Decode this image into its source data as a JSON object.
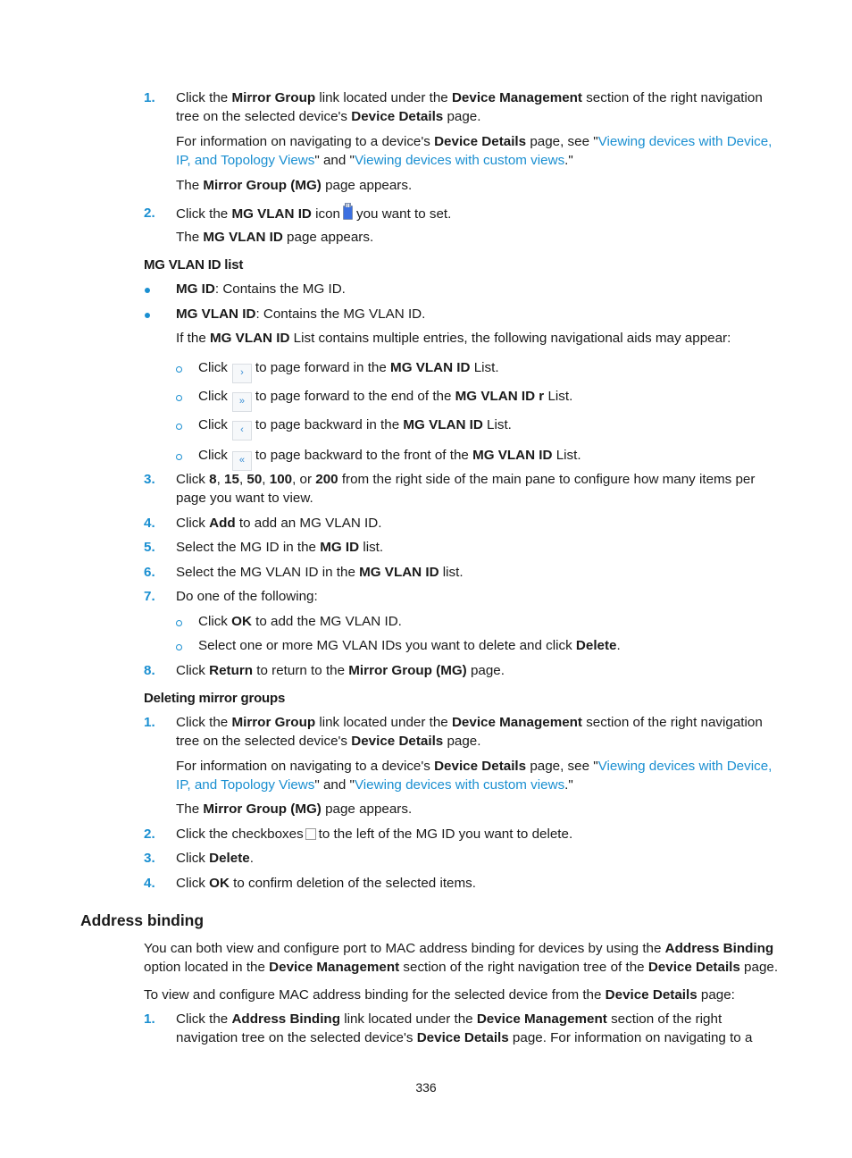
{
  "section1": {
    "step1": {
      "num": "1.",
      "line1_a": "Click the ",
      "line1_b": "Mirror Group",
      "line1_c": " link located under the ",
      "line1_d": "Device Management",
      "line1_e": " section of the right navigation",
      "line2_a": "tree on the selected device's ",
      "line2_b": "Device Details",
      "line2_c": " page.",
      "info1_a": "For information on navigating to a device's ",
      "info1_b": "Device Details",
      "info1_c": " page, see \"",
      "info1_link": "Viewing devices with Device,",
      "info2_link": "IP, and Topology Views",
      "info2_b": "\" and \"",
      "info2_link2": "Viewing devices with custom views",
      "info2_c": ".\"",
      "result_a": "The ",
      "result_b": "Mirror Group (MG)",
      "result_c": " page appears."
    },
    "step2": {
      "num": "2.",
      "a": "Click the ",
      "b": "MG VLAN ID",
      "c": " icon",
      "d": "you want to set.",
      "icon": "mg-vlan-id-icon",
      "result_a": "The ",
      "result_b": "MG VLAN ID",
      "result_c": " page appears."
    }
  },
  "vlan_list": {
    "heading": "MG VLAN ID list",
    "bullets": [
      {
        "label": "MG ID",
        "text": ": Contains the MG ID."
      },
      {
        "label": "MG VLAN ID",
        "text": ": Contains the MG VLAN ID."
      }
    ],
    "nav_intro_a": "If the ",
    "nav_intro_b": "MG VLAN ID",
    "nav_intro_c": " List contains multiple entries, the following navigational aids may appear:",
    "nav_items": [
      {
        "click": "Click",
        "icon_glyph": "›",
        "icon": "page-forward-icon",
        "a": "to page forward in the ",
        "b": "MG VLAN ID",
        "c": " List."
      },
      {
        "click": "Click",
        "icon_glyph": "»",
        "icon": "page-end-icon",
        "a": "to page forward to the end of the ",
        "b": "MG VLAN ID r",
        "c": " List."
      },
      {
        "click": "Click",
        "icon_glyph": "‹",
        "icon": "page-back-icon",
        "a": "to page backward in the ",
        "b": "MG VLAN ID",
        "c": " List."
      },
      {
        "click": "Click",
        "icon_glyph": "«",
        "icon": "page-front-icon",
        "a": "to page backward to the front of the ",
        "b": "MG VLAN ID",
        "c": " List."
      }
    ]
  },
  "steps_b": {
    "step3": {
      "num": "3.",
      "a": "Click ",
      "v1": "8",
      "s1": ", ",
      "v2": "15",
      "s2": ", ",
      "v3": "50",
      "s3": ", ",
      "v4": "100",
      "s4": ", or ",
      "v5": "200",
      "e": " from the right side of the main pane to configure how many items per",
      "line2": "page you want to view."
    },
    "step4": {
      "num": "4.",
      "a": "Click ",
      "b": "Add",
      "c": " to add an MG VLAN ID."
    },
    "step5": {
      "num": "5.",
      "a": "Select the MG ID in the ",
      "b": "MG ID",
      "c": " list."
    },
    "step6": {
      "num": "6.",
      "a": "Select the MG VLAN ID in the ",
      "b": "MG VLAN ID",
      "c": " list."
    },
    "step7": {
      "num": "7.",
      "a": "Do one of the following:",
      "sub1_a": "Click ",
      "sub1_b": "OK",
      "sub1_c": " to add the MG VLAN ID.",
      "sub2_a": "Select one or more MG VLAN IDs you want to delete and click ",
      "sub2_b": "Delete",
      "sub2_c": "."
    },
    "step8": {
      "num": "8.",
      "a": "Click ",
      "b": "Return",
      "c": " to return to the ",
      "d": "Mirror Group (MG)",
      "e": " page."
    }
  },
  "deleting": {
    "heading": "Deleting mirror groups",
    "step1": {
      "num": "1.",
      "line1_a": "Click the ",
      "line1_b": "Mirror Group",
      "line1_c": " link located under the ",
      "line1_d": "Device Management",
      "line1_e": " section of the right navigation",
      "line2_a": "tree on the selected device's ",
      "line2_b": "Device Details",
      "line2_c": " page.",
      "info1_a": "For information on navigating to a device's ",
      "info1_b": "Device Details",
      "info1_c": " page, see \"",
      "info1_link": "Viewing devices with Device,",
      "info2_link": "IP, and Topology Views",
      "info2_b": "\" and \"",
      "info2_link2": "Viewing devices with custom views",
      "info2_c": ".\"",
      "result_a": "The ",
      "result_b": "Mirror Group (MG)",
      "result_c": " page appears."
    },
    "step2": {
      "num": "2.",
      "a": "Click the checkboxes",
      "b": "to the left of the MG ID you want to delete."
    },
    "step3": {
      "num": "3.",
      "a": "Click ",
      "b": "Delete",
      "c": "."
    },
    "step4": {
      "num": "4.",
      "a": "Click ",
      "b": "OK",
      "c": " to confirm deletion of the selected items."
    }
  },
  "address_binding": {
    "heading": "Address binding",
    "p1_a": "You can both view and configure port to MAC address binding for devices by using the ",
    "p1_b": "Address Binding",
    "p1l2_a": "option located in the ",
    "p1l2_b": "Device Management",
    "p1l2_c": " section of the right navigation tree of the ",
    "p1l2_d": "Device Details",
    "p1l2_e": " page.",
    "p2_a": "To view and configure MAC address binding for the selected device from the ",
    "p2_b": "Device Details",
    "p2_c": " page:",
    "step1": {
      "num": "1.",
      "a": "Click the ",
      "b": "Address Binding",
      "c": " link located under the ",
      "d": "Device Management",
      "e": " section of the right",
      "l2_a": "navigation tree on the selected device's ",
      "l2_b": "Device Details",
      "l2_c": " page. For information on navigating to a"
    }
  },
  "page_number": "336",
  "colors": {
    "accent": "#1a8fd1",
    "text": "#1a1a1a"
  }
}
